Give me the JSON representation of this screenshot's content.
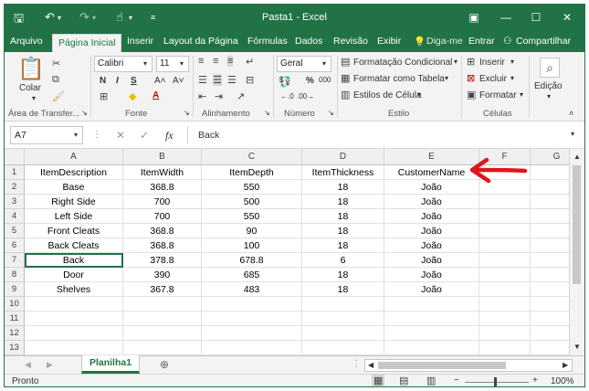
{
  "window": {
    "title": "Pasta1 - Excel"
  },
  "tabs": [
    {
      "label": "Arquivo"
    },
    {
      "label": "Página Inicial"
    },
    {
      "label": "Inserir"
    },
    {
      "label": "Layout da Página"
    },
    {
      "label": "Fórmulas"
    },
    {
      "label": "Dados"
    },
    {
      "label": "Revisão"
    },
    {
      "label": "Exibir"
    },
    {
      "label": "Diga-me"
    },
    {
      "label": "Entrar"
    },
    {
      "label": "Compartilhar"
    }
  ],
  "ribbon": {
    "paste_label": "Colar",
    "font_name": "Calibri",
    "font_size": "11",
    "number_format": "Geral",
    "percent": "%",
    "thousands": "000",
    "conditional_format": "Formatação Condicional",
    "format_table": "Formatar como Tabela",
    "cell_styles": "Estilos de Célula",
    "insert": "Inserir",
    "delete": "Excluir",
    "format": "Formatar",
    "edit": "Edição",
    "groups": {
      "clipboard": "Área de Transfer...",
      "font": "Fonte",
      "alignment": "Alinhamento",
      "number": "Número",
      "style": "Estilo",
      "cells": "Células"
    }
  },
  "formula_bar": {
    "name_box": "A7",
    "fx": "fx",
    "value": "Back"
  },
  "grid": {
    "columns": [
      "A",
      "B",
      "C",
      "D",
      "E",
      "F",
      "G"
    ],
    "rows": [
      [
        "ItemDescription",
        "ItemWidth",
        "ItemDepth",
        "ItemThickness",
        "CustomerName"
      ],
      [
        "Base",
        "368.8",
        "550",
        "18",
        "João"
      ],
      [
        "Right Side",
        "700",
        "500",
        "18",
        "João"
      ],
      [
        "Left Side",
        "700",
        "550",
        "18",
        "João"
      ],
      [
        "Front Cleats",
        "368.8",
        "90",
        "18",
        "João"
      ],
      [
        "Back Cleats",
        "368.8",
        "100",
        "18",
        "João"
      ],
      [
        "Back",
        "378.8",
        "678.8",
        "6",
        "João"
      ],
      [
        "Door",
        "390",
        "685",
        "18",
        "João"
      ],
      [
        "Shelves",
        "367.8",
        "483",
        "18",
        "João"
      ],
      [
        "",
        "",
        "",
        "",
        ""
      ],
      [
        "",
        "",
        "",
        "",
        ""
      ],
      [
        "",
        "",
        "",
        "",
        ""
      ],
      [
        "",
        "",
        "",
        "",
        ""
      ]
    ],
    "row_numbers": [
      "1",
      "2",
      "3",
      "4",
      "5",
      "6",
      "7",
      "8",
      "9",
      "10",
      "11",
      "12",
      "13"
    ]
  },
  "sheet_tab": "Planilha1",
  "status": {
    "ready": "Pronto",
    "zoom": "100%"
  },
  "colors": {
    "excel_green": "#217346",
    "annotation_red": "#e0151b"
  }
}
